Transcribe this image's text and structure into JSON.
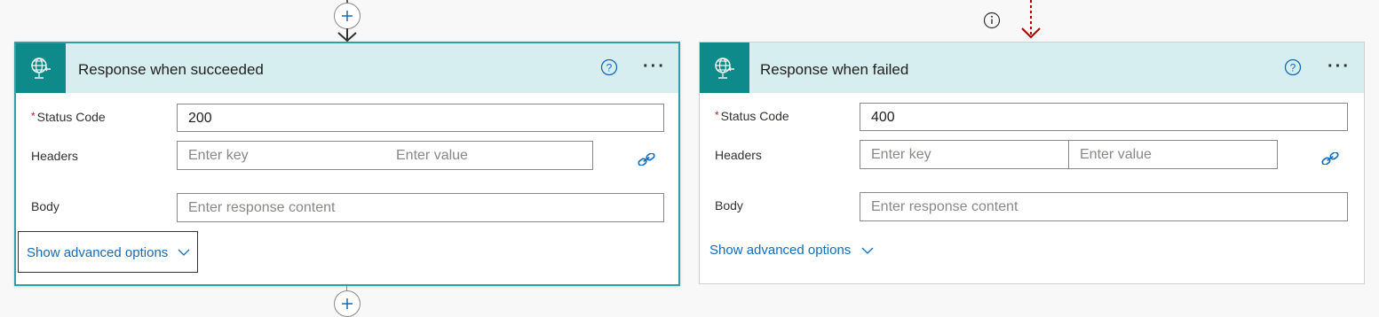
{
  "flow": {
    "add_step_top": "+",
    "add_step_bottom": "+",
    "info": "i"
  },
  "cards": {
    "success": {
      "title": "Response when succeeded",
      "help": "?",
      "more": "···",
      "status_label": "Status Code",
      "required_marker": "*",
      "status_value": "200",
      "headers_label": "Headers",
      "key_placeholder": "Enter key",
      "value_placeholder": "Enter value",
      "body_label": "Body",
      "body_placeholder": "Enter response content",
      "advanced": "Show advanced options"
    },
    "failed": {
      "title": "Response when failed",
      "help": "?",
      "more": "···",
      "status_label": "Status Code",
      "required_marker": "*",
      "status_value": "400",
      "headers_label": "Headers",
      "key_placeholder": "Enter key",
      "value_placeholder": "Enter value",
      "body_label": "Body",
      "body_placeholder": "Enter response content",
      "advanced": "Show advanced options"
    }
  },
  "colors": {
    "header_bg": "#d7eef0",
    "icon_tile": "#0f8a8a",
    "selected_border": "#2f9ea5",
    "link": "#0f6cbd",
    "failed_connector": "#a80000"
  },
  "icons": {
    "action": "globe-response-icon",
    "help": "question-circle-icon",
    "more": "ellipsis-icon",
    "dynamic_content": "link-icon",
    "chevron": "chevron-down-icon",
    "add": "plus-icon",
    "info": "info-icon",
    "arrow": "arrow-down-icon"
  }
}
